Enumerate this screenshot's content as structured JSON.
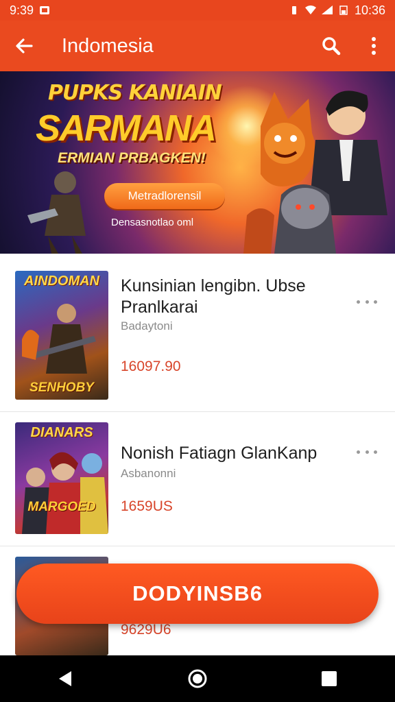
{
  "status_bar": {
    "time_left": "9:39",
    "time_right": "10:36"
  },
  "app_bar": {
    "title": "Indomesia",
    "back_icon": "arrow-left-icon",
    "search_icon": "search-icon",
    "more_icon": "more-vert-icon"
  },
  "banner": {
    "line1": "PUPKS KANIAIN",
    "line2": "SARMANA",
    "line3": "ERMIAN PRBAGKEN!",
    "button_label": "Metradlorensil",
    "subtext": "Densasnotlao oml"
  },
  "items": [
    {
      "thumb_title": "AINDOMAN",
      "thumb_bottom": "SENHOBY",
      "title": "Kunsinian lengibn. Ubse Pranlkarai",
      "subtitle": "Badaytoni",
      "price": "16097.90"
    },
    {
      "thumb_title": "DIANARS",
      "thumb_bottom": "MARGOED",
      "title": "Nonish Fatiagn GlanKanp",
      "subtitle": "Asbanonni",
      "price": "1659US"
    },
    {
      "thumb_title": "",
      "thumb_bottom": "",
      "title": "",
      "subtitle": "",
      "price": "9629U6"
    }
  ],
  "fab": {
    "label": "DODYINSB6"
  },
  "nav_bar": {
    "back_icon": "triangle-back-icon",
    "home_icon": "circle-home-icon",
    "recents_icon": "square-recents-icon"
  },
  "colors": {
    "accent": "#ea4a1f",
    "price": "#d8452a"
  }
}
